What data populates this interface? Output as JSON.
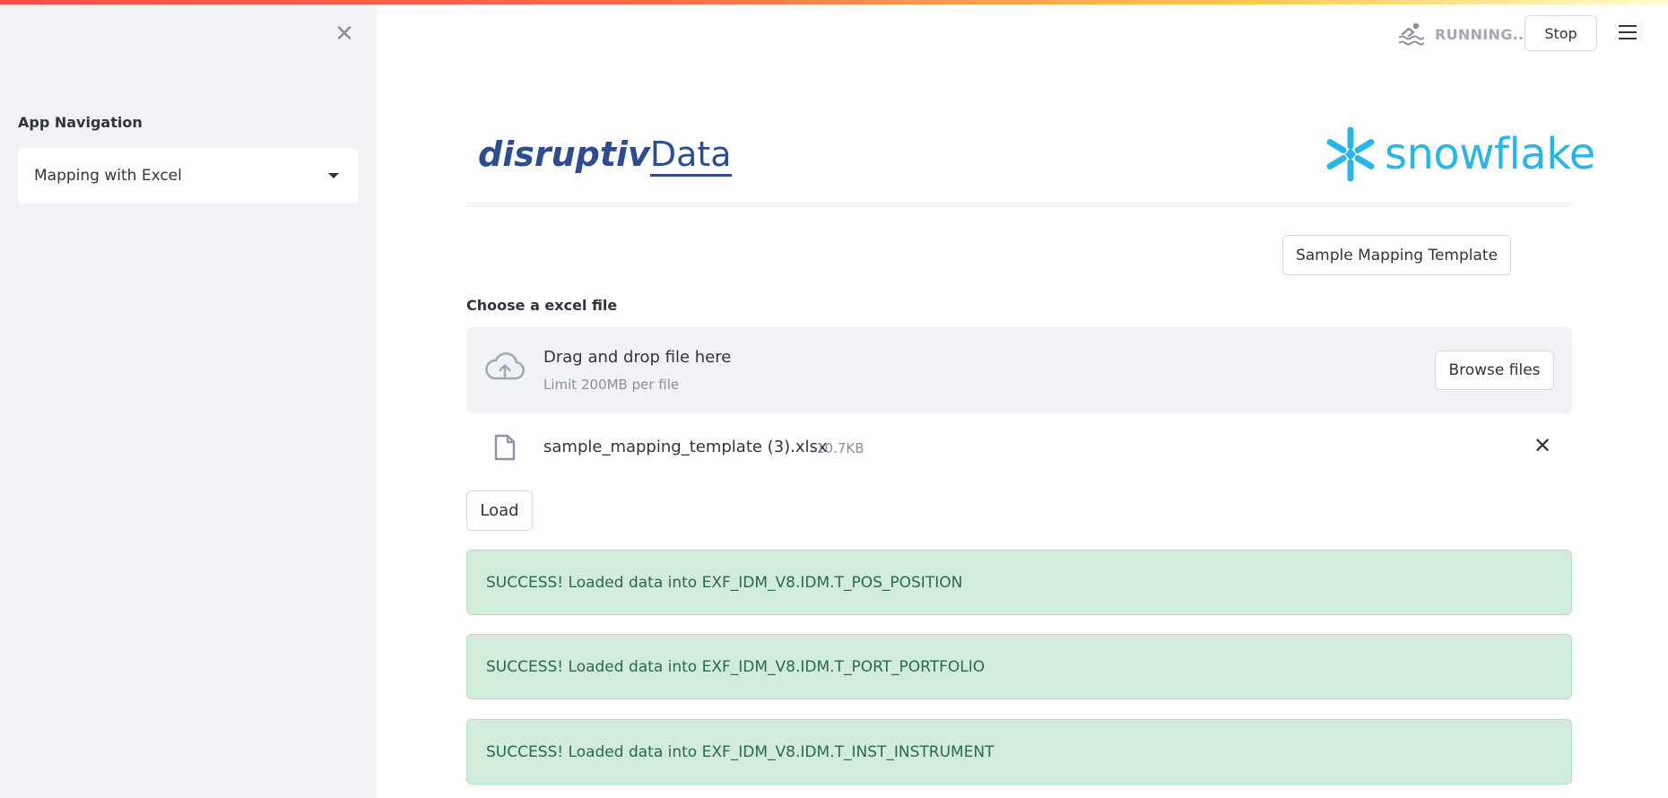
{
  "sidebar": {
    "nav_label": "App Navigation",
    "selected_page": "Mapping with Excel"
  },
  "header": {
    "status_text": "RUNNING...",
    "stop_label": "Stop"
  },
  "logos": {
    "left_bold": "disruptiv",
    "left_regular": "Data",
    "right_word": "snowflake"
  },
  "main": {
    "template_button_label": "Sample Mapping Template",
    "upload_label": "Choose a excel file",
    "dropzone_title": "Drag and drop file here",
    "dropzone_limit": "Limit 200MB per file",
    "browse_label": "Browse files",
    "uploaded_file": {
      "name": "sample_mapping_template (3).xlsx",
      "size": "10.7KB"
    },
    "load_label": "Load",
    "alerts": [
      "SUCCESS! Loaded data into EXF_IDM_V8.IDM.T_POS_POSITION",
      "SUCCESS! Loaded data into EXF_IDM_V8.IDM.T_PORT_PORTFOLIO",
      "SUCCESS! Loaded data into EXF_IDM_V8.IDM.T_INST_INSTRUMENT"
    ]
  },
  "colors": {
    "accent_red": "#ff4b4b",
    "brand_blue": "#2d4d8f",
    "snowflake_blue": "#29b5e8",
    "success_bg": "#d1ecdb",
    "success_text": "#2b6a43"
  },
  "icons": {
    "sidebar_close": "close-icon",
    "status": "swimmer-icon",
    "menu": "hamburger-menu-icon",
    "upload": "cloud-upload-icon",
    "file": "file-icon",
    "remove_file": "close-icon",
    "snowflake": "snowflake-icon"
  }
}
